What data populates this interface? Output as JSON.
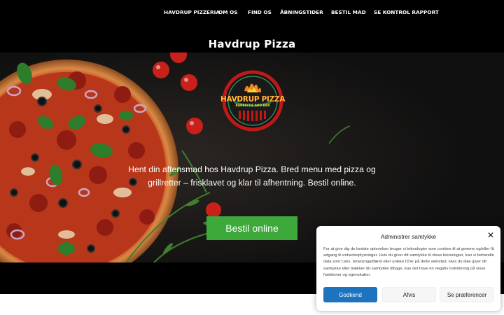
{
  "nav": {
    "items": [
      "HAVDRUP PIZZERIA",
      "OM OS",
      "FIND OS",
      "ÅBNINGSTIDER",
      "BESTIL MAD",
      "SE KONTROL RAPPORT"
    ]
  },
  "site_title": "Havdrup Pizza",
  "logo": {
    "line1": "HAVDRUP PIZZA",
    "line2": "BARBECUE AND BAR"
  },
  "hero": {
    "text": "Hent din aftensmad hos Havdrup Pizza. Bred menu med pizza og grillretter – frisklavet og klar til afhentning. Bestil online.",
    "button": "Bestil online"
  },
  "cookie_banner": {
    "title": "Administrer samtykke",
    "body": "For at give dig de bedste oplevelser bruger vi teknologier som cookies til at gemme og/eller få adgang til enhedsoplysninger. Hvis du giver dit samtykke til disse teknologier, kan vi behandle data som f.eks. browsingadfærd eller unikke ID'er på dette websted. Hvis du ikke giver dit samtykke eller trækker dit samtykke tilbage, kan det have en negativ indvirkning på visse funktioner og egenskaber.",
    "accept": "Godkend",
    "deny": "Afvis",
    "preferences": "Se præferencer"
  },
  "colors": {
    "accent_green": "#3da93a",
    "accept_blue": "#1e73be",
    "background": "#000000"
  }
}
